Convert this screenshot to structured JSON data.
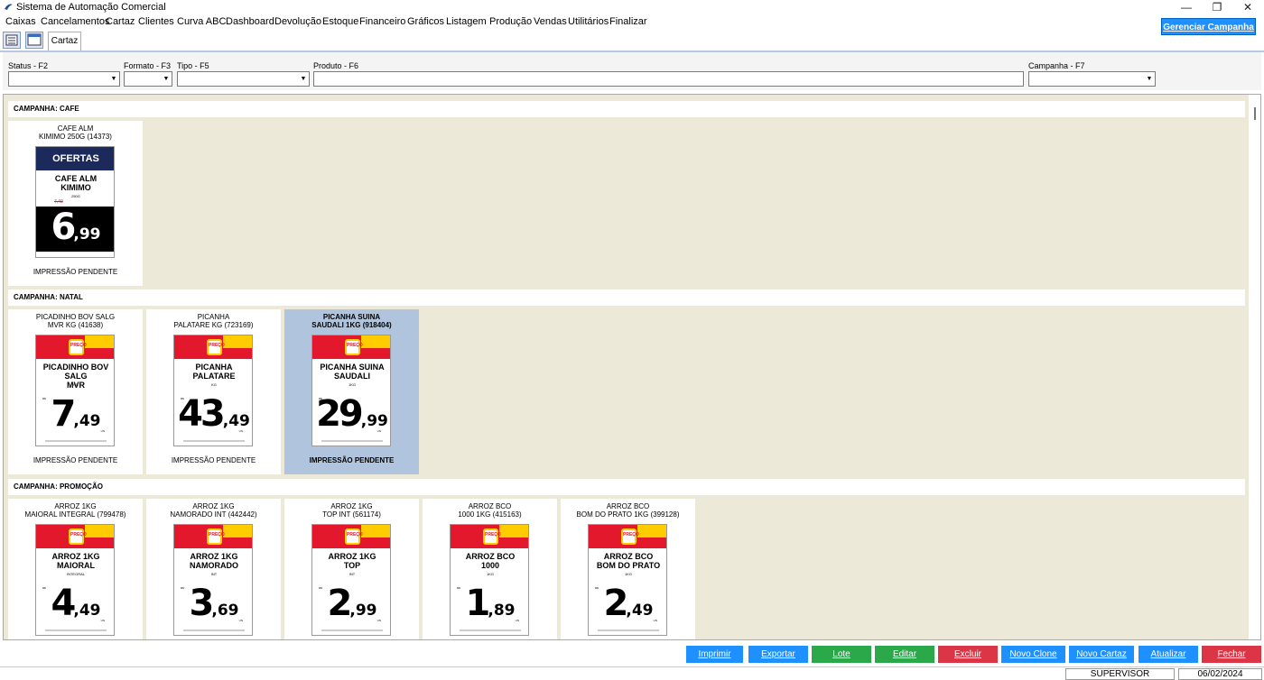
{
  "window": {
    "title": "Sistema de Automação Comercial",
    "minimize": "—",
    "maximize": "❐",
    "close": "✕"
  },
  "menu": [
    "Caixas",
    "Cancelamentos",
    "Cartaz",
    "Clientes",
    "Curva ABC",
    "Dashboard",
    "Devolução",
    "Estoque",
    "Financeiro",
    "Gráficos",
    "Listagem",
    "Produção",
    "Vendas",
    "Utilitários",
    "Finalizar"
  ],
  "tab": {
    "label": "Cartaz"
  },
  "filters": {
    "status_label": "Status - F2",
    "formato_label": "Formato - F3",
    "tipo_label": "Tipo - F5",
    "produto_label": "Produto - F6",
    "campanha_label": "Campanha - F7",
    "gerenciar_label": "Gerenciar Campanha"
  },
  "campaigns": [
    {
      "title": "CAMPANHA: CAFE",
      "cards": [
        {
          "name": "CAFE ALM\nKIMIMO 250G (14373)",
          "poster_title": "CAFE ALM\nKIMIMO",
          "unit": "250G",
          "old_price": "7,49",
          "banner": "OFERTAS",
          "price_int": "6",
          "price_dec": ",99",
          "status": "IMPRESSÃO PENDENTE",
          "style": "dark"
        }
      ]
    },
    {
      "title": "CAMPANHA: NATAL",
      "cards": [
        {
          "name": "PICADINHO BOV SALG\nMVR KG (41638)",
          "poster_title": "PICADINHO BOV SALG\nMVR",
          "unit": "KG",
          "price_int": "7",
          "price_dec": ",49",
          "status": "IMPRESSÃO PENDENTE"
        },
        {
          "name": "PICANHA\nPALATARE KG (723169)",
          "poster_title": "PICANHA\nPALATARE",
          "unit": "KG",
          "price_int": "43",
          "price_dec": ",49",
          "status": "IMPRESSÃO PENDENTE"
        },
        {
          "name": "PICANHA SUINA\nSAUDALI 1KG (918404)",
          "poster_title": "PICANHA SUINA\nSAUDALI",
          "unit": "1KG",
          "price_int": "29",
          "price_dec": ",99",
          "status": "IMPRESSÃO PENDENTE",
          "selected": true
        }
      ]
    },
    {
      "title": "CAMPANHA: PROMOÇÃO",
      "cards": [
        {
          "name": "ARROZ 1KG\nMAIORAL INTEGRAL (799478)",
          "poster_title": "ARROZ 1KG\nMAIORAL",
          "unit": "INTEGRAL",
          "price_int": "4",
          "price_dec": ",49"
        },
        {
          "name": "ARROZ 1KG\nNAMORADO INT (442442)",
          "poster_title": "ARROZ 1KG\nNAMORADO",
          "unit": "INT",
          "price_int": "3",
          "price_dec": ",69"
        },
        {
          "name": "ARROZ 1KG\nTOP INT (561174)",
          "poster_title": "ARROZ 1KG\nTOP",
          "unit": "INT",
          "price_int": "2",
          "price_dec": ",99"
        },
        {
          "name": "ARROZ BCO\n1000 1KG (415163)",
          "poster_title": "ARROZ BCO\n1000",
          "unit": "1KG",
          "price_int": "1",
          "price_dec": ",89"
        },
        {
          "name": "ARROZ BCO\nBOM DO PRATO 1KG (399128)",
          "poster_title": "ARROZ BCO\nBOM DO PRATO",
          "unit": "1KG",
          "price_int": "2",
          "price_dec": ",49"
        }
      ]
    }
  ],
  "poster_badge": "PREÇO",
  "poster_rs": "R$",
  "poster_un": "UN",
  "buttons": {
    "imprimir": "Imprimir",
    "exportar": "Exportar",
    "lote": "Lote",
    "editar": "Editar",
    "excluir": "Excluir",
    "novo_clone": "Novo Clone",
    "novo_cartaz": "Novo Cartaz",
    "atualizar": "Atualizar",
    "fechar": "Fechar"
  },
  "statusbar": {
    "user": "SUPERVISOR",
    "date": "06/02/2024"
  },
  "colors": {
    "accent_blue": "#1e90ff",
    "green": "#2aa84a",
    "red": "#dc3545",
    "content_bg": "#ece9d8",
    "selected_card": "#b0c4de"
  }
}
